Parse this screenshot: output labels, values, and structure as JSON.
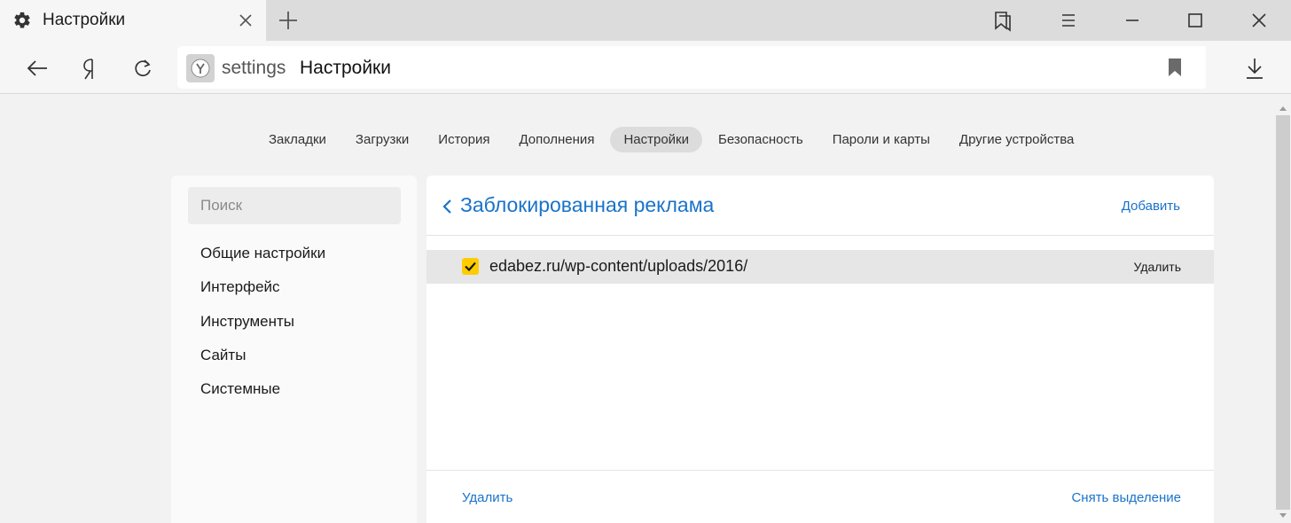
{
  "tab": {
    "title": "Настройки"
  },
  "address": {
    "host": "settings",
    "title": "Настройки"
  },
  "settings_nav": {
    "items": [
      {
        "label": "Закладки",
        "active": false
      },
      {
        "label": "Загрузки",
        "active": false
      },
      {
        "label": "История",
        "active": false
      },
      {
        "label": "Дополнения",
        "active": false
      },
      {
        "label": "Настройки",
        "active": true
      },
      {
        "label": "Безопасность",
        "active": false
      },
      {
        "label": "Пароли и карты",
        "active": false
      },
      {
        "label": "Другие устройства",
        "active": false
      }
    ]
  },
  "sidebar": {
    "search_placeholder": "Поиск",
    "items": [
      {
        "label": "Общие настройки"
      },
      {
        "label": "Интерфейс"
      },
      {
        "label": "Инструменты"
      },
      {
        "label": "Сайты"
      },
      {
        "label": "Системные"
      }
    ]
  },
  "panel": {
    "title": "Заблокированная реклама",
    "add_label": "Добавить",
    "rows": [
      {
        "url": "edabez.ru/wp-content/uploads/2016/",
        "checked": true,
        "delete_label": "Удалить"
      }
    ],
    "footer": {
      "delete_label": "Удалить",
      "deselect_label": "Снять выделение"
    }
  },
  "colors": {
    "accent": "#1a73c9",
    "checkbox": "#ffcc00"
  },
  "icons": {
    "tab": [
      "gear-icon",
      "close-icon",
      "plus-icon"
    ],
    "window": [
      "bookmarks-panel-icon",
      "menu-icon",
      "minimize-icon",
      "maximize-icon",
      "close-icon"
    ],
    "toolbar": [
      "back-arrow-icon",
      "yandex-logo-icon",
      "reload-icon",
      "yandex-browser-icon",
      "bookmark-icon",
      "download-icon"
    ]
  }
}
